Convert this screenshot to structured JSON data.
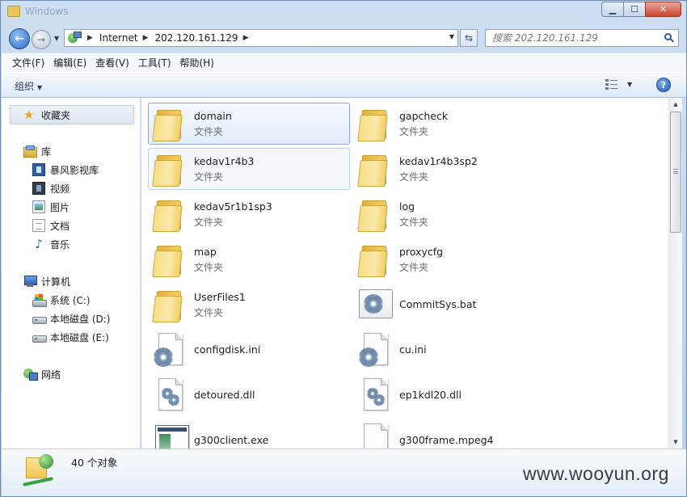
{
  "window": {
    "title": "Windows"
  },
  "nav_buttons": {
    "back": "back",
    "forward": "forward"
  },
  "address": {
    "crumbs": [
      "Internet",
      "202.120.161.129"
    ]
  },
  "search": {
    "placeholder": "搜索 202.120.161.129"
  },
  "menu": [
    "文件(F)",
    "编辑(E)",
    "查看(V)",
    "工具(T)",
    "帮助(H)"
  ],
  "toolbar": {
    "organize": "组织",
    "help": "?"
  },
  "nav": {
    "favorites": "收藏夹",
    "libraries": "库",
    "library_items": [
      "暴风影视库",
      "视频",
      "图片",
      "文档",
      "音乐"
    ],
    "computer": "计算机",
    "drives": [
      "系统 (C:)",
      "本地磁盘 (D:)",
      "本地磁盘 (E:)"
    ],
    "network": "网络"
  },
  "items": [
    {
      "name": "domain",
      "type": "文件夹",
      "icon": "folder-icon"
    },
    {
      "name": "gapcheck",
      "type": "文件夹",
      "icon": "folder-icon"
    },
    {
      "name": "kedav1r4b3",
      "type": "文件夹",
      "icon": "folder-icon"
    },
    {
      "name": "kedav1r4b3sp2",
      "type": "文件夹",
      "icon": "folder-icon"
    },
    {
      "name": "kedav5r1b1sp3",
      "type": "文件夹",
      "icon": "folder-icon"
    },
    {
      "name": "log",
      "type": "文件夹",
      "icon": "folder-icon"
    },
    {
      "name": "map",
      "type": "文件夹",
      "icon": "folder-icon"
    },
    {
      "name": "proxycfg",
      "type": "文件夹",
      "icon": "folder-icon"
    },
    {
      "name": "UserFiles1",
      "type": "文件夹",
      "icon": "folder-icon"
    },
    {
      "name": "CommitSys.bat",
      "type": "",
      "icon": "batch-file-icon"
    },
    {
      "name": "configdisk.ini",
      "type": "",
      "icon": "config-file-icon"
    },
    {
      "name": "cu.ini",
      "type": "",
      "icon": "config-file-icon"
    },
    {
      "name": "detoured.dll",
      "type": "",
      "icon": "dll-file-icon"
    },
    {
      "name": "ep1kdl20.dll",
      "type": "",
      "icon": "dll-file-icon"
    },
    {
      "name": "g300client.exe",
      "type": "",
      "icon": "exe-file-icon"
    },
    {
      "name": "g300frame.mpeg4",
      "type": "",
      "icon": "blank-file-icon"
    }
  ],
  "status": {
    "count": "40 个对象"
  },
  "watermark": "www.wooyun.org"
}
